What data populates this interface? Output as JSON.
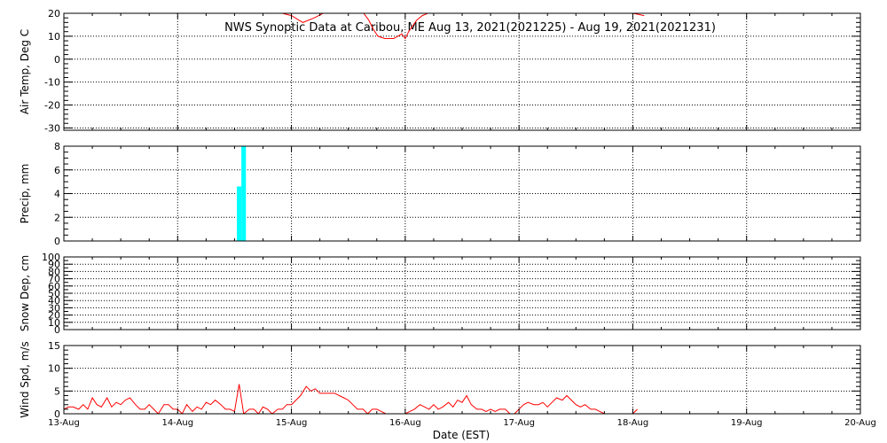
{
  "title": "NWS Synoptic Data at Caribou, ME   Aug 13, 2021(2021225) - Aug 19, 2021(2021231)",
  "xlabel": "Date (EST)",
  "colors": {
    "temp": "#ff0000",
    "precip": "#00ffff",
    "wind": "#ff0000",
    "frame": "#000000"
  },
  "chart_data": [
    {
      "type": "line",
      "ylabel": "Air Temp, Deg C",
      "ylim": [
        -31,
        20
      ],
      "yticks": [
        -30,
        -20,
        -10,
        0,
        10,
        20
      ],
      "ytick_labels": [
        "-30",
        "-20",
        "-10",
        "0",
        "10",
        "20"
      ],
      "series": [
        {
          "x": [
            1.92,
            2.0,
            2.1,
            2.2,
            2.28,
            2.35,
            2.45,
            2.55,
            2.62,
            2.68,
            2.72,
            2.76,
            2.82,
            2.9,
            2.97,
            3.0,
            3.03,
            3.1,
            3.15,
            3.2,
            3.3,
            3.4,
            3.45,
            3.5,
            3.55,
            3.58
          ],
          "y": [
            20,
            19,
            16,
            18,
            20,
            23,
            26,
            24,
            21,
            17,
            13,
            10,
            9,
            9,
            11,
            9,
            12,
            17,
            19,
            20,
            24,
            26,
            25,
            23,
            21,
            20
          ]
        },
        {
          "x": [
            5.0,
            5.05,
            5.1
          ],
          "y": [
            20,
            19.5,
            19
          ]
        }
      ]
    },
    {
      "type": "bar",
      "ylabel": "Precip, mm",
      "ylim": [
        0,
        8
      ],
      "yticks": [
        0,
        2,
        4,
        6,
        8
      ],
      "ytick_labels": [
        "0",
        "2",
        "4",
        "6",
        "8"
      ],
      "bars": [
        {
          "x0": 1.52,
          "x1": 1.56,
          "value": 4.6
        },
        {
          "x0": 1.56,
          "x1": 1.6,
          "value": 8.0
        }
      ]
    },
    {
      "type": "line",
      "ylabel": "Snow Dep, cm",
      "ylim": [
        0,
        100
      ],
      "yticks": [
        0,
        10,
        20,
        30,
        40,
        50,
        60,
        70,
        80,
        90,
        100
      ],
      "ytick_labels": [
        "0",
        "10",
        "20",
        "30",
        "40",
        "50",
        "60",
        "70",
        "80",
        "90",
        "100"
      ],
      "series": []
    },
    {
      "type": "line",
      "ylabel": "Wind Spd, m/s",
      "ylim": [
        0,
        15
      ],
      "yticks": [
        0,
        5,
        10,
        15
      ],
      "ytick_labels": [
        "0",
        "5",
        "10",
        "15"
      ],
      "series": [
        {
          "x": [
            0.0,
            0.04,
            0.08,
            0.13,
            0.17,
            0.21,
            0.25,
            0.29,
            0.33,
            0.38,
            0.42,
            0.46,
            0.5,
            0.54,
            0.58,
            0.63,
            0.67,
            0.71,
            0.75,
            0.79,
            0.83,
            0.88,
            0.92,
            0.96,
            1.0,
            1.04,
            1.08,
            1.13,
            1.17,
            1.21,
            1.25,
            1.29,
            1.33,
            1.38,
            1.42,
            1.46,
            1.5,
            1.54,
            1.58,
            1.63,
            1.67,
            1.71,
            1.75,
            1.79,
            1.83,
            1.88,
            1.92,
            1.96,
            2.0,
            2.04,
            2.08,
            2.13,
            2.17,
            2.21,
            2.25,
            2.29,
            2.33,
            2.38,
            2.42,
            2.46,
            2.5,
            2.54,
            2.58,
            2.63,
            2.67,
            2.71,
            2.75,
            2.79,
            2.83,
            2.88,
            2.92,
            2.96,
            3.0,
            3.04,
            3.08,
            3.13,
            3.17,
            3.21,
            3.25,
            3.29,
            3.33,
            3.38,
            3.42,
            3.46,
            3.5,
            3.54,
            3.58,
            3.63,
            3.67,
            3.71,
            3.75,
            3.79,
            3.83,
            3.88,
            3.92,
            3.96,
            4.0,
            4.04,
            4.08,
            4.13,
            4.17,
            4.21,
            4.25,
            4.29,
            4.33,
            4.38,
            4.42,
            4.46,
            4.5,
            4.54,
            4.58,
            4.63,
            4.67,
            4.71,
            4.75,
            4.79,
            4.83,
            4.88,
            4.92,
            4.96,
            5.0,
            5.04
          ],
          "y": [
            1.0,
            1.5,
            1.5,
            1.0,
            2.0,
            1.0,
            3.5,
            2.0,
            1.5,
            3.5,
            1.5,
            2.5,
            2.0,
            3.0,
            3.5,
            2.0,
            1.0,
            1.0,
            2.0,
            1.0,
            0.0,
            2.0,
            2.0,
            1.0,
            1.0,
            0.0,
            2.0,
            0.5,
            1.5,
            1.0,
            2.5,
            2.0,
            3.0,
            2.0,
            1.0,
            1.0,
            0.5,
            6.5,
            0.0,
            1.0,
            1.0,
            0.0,
            1.5,
            1.0,
            0.0,
            1.0,
            1.0,
            2.0,
            2.0,
            3.0,
            4.0,
            6.0,
            5.0,
            5.5,
            4.5,
            4.5,
            4.5,
            4.5,
            4.0,
            3.5,
            3.0,
            2.0,
            1.0,
            1.0,
            0.0,
            1.0,
            1.0,
            0.5,
            0.0,
            0.0,
            0.0,
            0.0,
            0.0,
            0.5,
            1.0,
            2.0,
            1.5,
            1.0,
            2.0,
            1.0,
            1.5,
            2.5,
            1.5,
            3.0,
            2.5,
            4.0,
            2.0,
            1.0,
            1.0,
            0.5,
            1.0,
            0.5,
            1.0,
            1.0,
            0.0,
            0.0,
            1.0,
            2.0,
            2.5,
            2.0,
            2.0,
            2.5,
            1.5,
            2.5,
            3.5,
            3.0,
            4.0,
            3.0,
            2.0,
            1.5,
            2.0,
            1.0,
            1.0,
            0.5,
            0.0,
            0.0,
            0.0,
            0.0,
            0.0,
            0.0,
            0.0,
            1.0
          ]
        }
      ]
    }
  ],
  "x_axis": {
    "ticks": [
      0,
      1,
      2,
      3,
      4,
      5,
      6,
      7
    ],
    "tick_labels": [
      "13-Aug",
      "14-Aug",
      "15-Aug",
      "16-Aug",
      "17-Aug",
      "18-Aug",
      "19-Aug",
      "20-Aug"
    ],
    "range": [
      0,
      7
    ]
  }
}
